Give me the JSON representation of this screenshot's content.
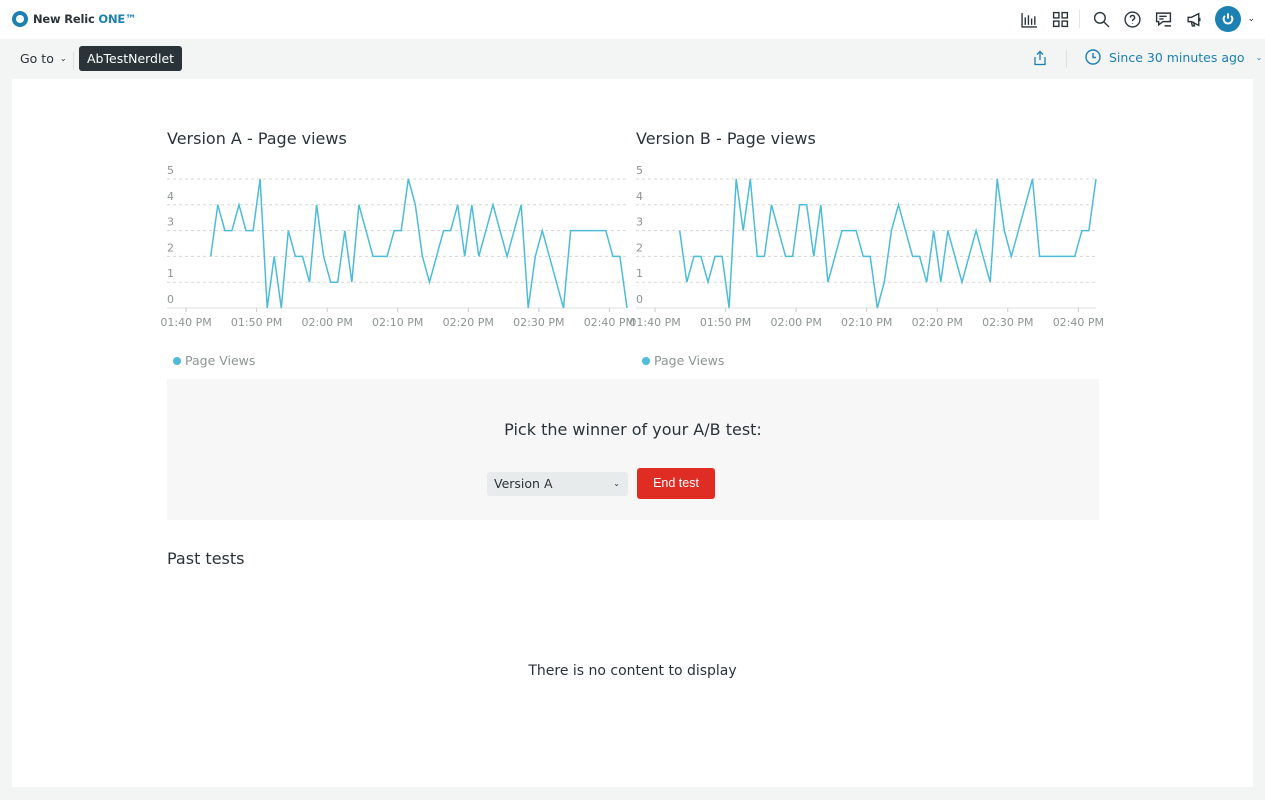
{
  "app": {
    "brand": "New Relic",
    "brand_suffix": "ONE™"
  },
  "topbar_icons": [
    "chart-builder-icon",
    "apps-grid-icon",
    "search-icon",
    "help-icon",
    "feedback-icon",
    "announcements-icon",
    "user-avatar-icon"
  ],
  "nav": {
    "goto_label": "Go to",
    "breadcrumb": "AbTestNerdlet",
    "time_picker": "Since 30 minutes ago"
  },
  "colors": {
    "series": "#4cbcd8",
    "accent": "#1d80b2",
    "danger": "#df2d24"
  },
  "chart_data": [
    {
      "type": "line",
      "title": "Version A - Page views",
      "xlabel": "",
      "ylabel": "",
      "x_tick_labels": [
        "01:40 PM",
        "01:50 PM",
        "02:00 PM",
        "02:10 PM",
        "02:20 PM",
        "02:30 PM",
        "02:40 PM"
      ],
      "x_start_minute": 0,
      "x_range_minutes": [
        -2.7,
        62.5
      ],
      "ylim": [
        0,
        5
      ],
      "y_ticks": [
        0,
        1,
        2,
        3,
        4,
        5
      ],
      "grid": true,
      "legend": {
        "position": "bottom-left",
        "entries": [
          "Page Views"
        ]
      },
      "series": [
        {
          "name": "Page Views",
          "start_minute": 3.5,
          "values": [
            2,
            4,
            3,
            3,
            4,
            3,
            3,
            5,
            0,
            2,
            0,
            3,
            2,
            2,
            1,
            4,
            2,
            1,
            1,
            3,
            1,
            4,
            3,
            2,
            2,
            2,
            3,
            3,
            5,
            4,
            2,
            1,
            2,
            3,
            3,
            4,
            2,
            4,
            2,
            3,
            4,
            3,
            2,
            3,
            4,
            0,
            2,
            3,
            2,
            1,
            0,
            3,
            3,
            3,
            3,
            3,
            3,
            2,
            2,
            0
          ]
        }
      ]
    },
    {
      "type": "line",
      "title": "Version B - Page views",
      "xlabel": "",
      "ylabel": "",
      "x_tick_labels": [
        "01:40 PM",
        "01:50 PM",
        "02:00 PM",
        "02:10 PM",
        "02:20 PM",
        "02:30 PM",
        "02:40 PM"
      ],
      "x_start_minute": 0,
      "x_range_minutes": [
        -2.7,
        62.5
      ],
      "ylim": [
        0,
        5
      ],
      "y_ticks": [
        0,
        1,
        2,
        3,
        4,
        5
      ],
      "grid": true,
      "legend": {
        "position": "bottom-left",
        "entries": [
          "Page Views"
        ]
      },
      "series": [
        {
          "name": "Page Views",
          "start_minute": 3.5,
          "values": [
            3,
            1,
            2,
            2,
            1,
            2,
            2,
            0,
            5,
            3,
            5,
            2,
            2,
            4,
            3,
            2,
            2,
            4,
            4,
            2,
            4,
            1,
            2,
            3,
            3,
            3,
            2,
            2,
            0,
            1,
            3,
            4,
            3,
            2,
            2,
            1,
            3,
            1,
            3,
            2,
            1,
            2,
            3,
            2,
            1,
            5,
            3,
            2,
            3,
            4,
            5,
            2,
            2,
            2,
            2,
            2,
            2,
            3,
            3,
            5
          ]
        }
      ]
    }
  ],
  "picker": {
    "title": "Pick the winner of your A/B test:",
    "selected": "Version A",
    "end_button": "End test"
  },
  "past_tests": {
    "title": "Past tests",
    "empty_message": "There is no content to display"
  }
}
